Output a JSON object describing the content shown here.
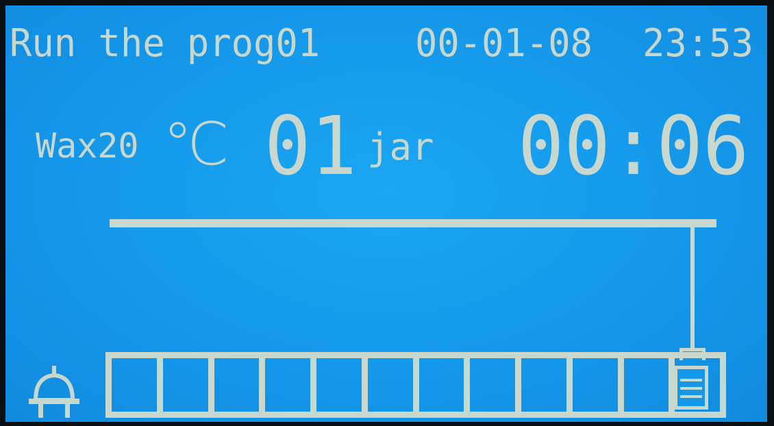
{
  "status": {
    "program": "Run the prog01",
    "date": "00-01-08",
    "time": "23:53"
  },
  "wax": {
    "label": "Wax20",
    "unit": "℃"
  },
  "jar": {
    "number": "01",
    "unit": "jar"
  },
  "timer": "00:06",
  "track": {
    "jar_slots": 12,
    "current_slot": 12
  },
  "icons": {
    "power": "plug-icon",
    "basket": "basket-icon"
  },
  "colors": {
    "background": "#1598ea",
    "foreground": "#c9d8cf"
  }
}
